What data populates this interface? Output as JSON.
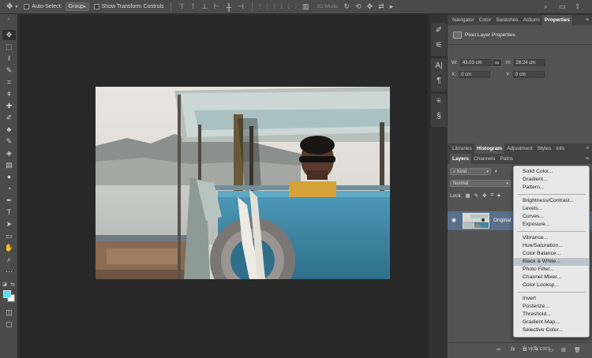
{
  "options_bar": {
    "auto_select_label": "Auto-Select:",
    "auto_select_value": "Group",
    "transform_label": "Show Transform Controls",
    "mode_3d_label": "3D Mode:"
  },
  "toolbar": {
    "foreground_color": "#4fe3f0",
    "background_color": "#ffffff",
    "tools": [
      "move-icon",
      "marquee-icon",
      "lasso-icon",
      "quick-select-icon",
      "crop-icon",
      "eyedropper-icon",
      "healing-icon",
      "brush-icon",
      "stamp-icon",
      "history-brush-icon",
      "eraser-icon",
      "gradient-icon",
      "blur-icon",
      "dodge-icon",
      "pen-icon",
      "type-icon",
      "path-select-icon",
      "rectangle-icon",
      "hand-icon",
      "zoom-icon",
      "more-icon"
    ]
  },
  "properties_panel": {
    "tabs": [
      "Navigator",
      "Color",
      "Swatches",
      "Actions",
      "Properties"
    ],
    "active_tab": "Properties",
    "title": "Pixel Layer Properties",
    "w_label": "W:",
    "w_value": "43.03 cm",
    "h_label": "H:",
    "h_value": "28.24 cm",
    "x_label": "X:",
    "x_value": "0 cm",
    "y_label": "Y:",
    "y_value": "0 cm"
  },
  "library_panel": {
    "tabs": [
      "Libraries",
      "Histogram",
      "Adjustment",
      "Styles",
      "Info"
    ],
    "active_tab": "Histogram"
  },
  "layers_panel": {
    "tabs": [
      "Layers",
      "Channels",
      "Paths"
    ],
    "active_tab": "Layers",
    "filter_label": "Kind",
    "blend_mode": "Normal",
    "lock_label": "Lock:",
    "layer_name": "Original",
    "footer_fx": "fx"
  },
  "adjustment_menu": {
    "groups": [
      [
        "Solid Color...",
        "Gradient...",
        "Pattern..."
      ],
      [
        "Brightness/Contrast...",
        "Levels...",
        "Curves...",
        "Exposure..."
      ],
      [
        "Vibrance...",
        "Hue/Saturation...",
        "Color Balance...",
        "Black & White...",
        "Photo Filter...",
        "Channel Mixer...",
        "Color Lookup..."
      ],
      [
        "Invert",
        "Posterize...",
        "Threshold...",
        "Gradient Map...",
        "Selective Color..."
      ]
    ],
    "highlighted": "Black & White..."
  },
  "watermark": "© vjdb.com"
}
